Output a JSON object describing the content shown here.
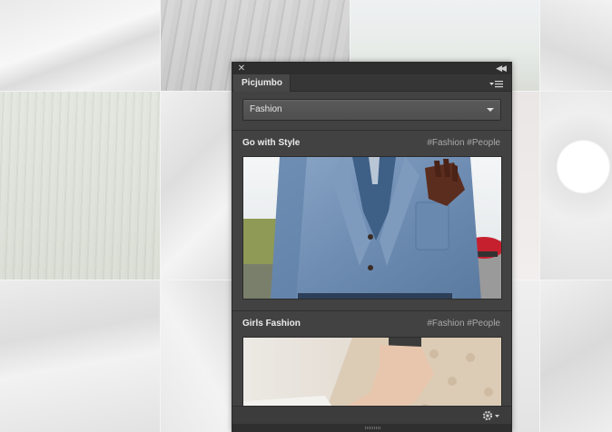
{
  "panel": {
    "tab_label": "Picjumbo",
    "category_dropdown": {
      "selected": "Fashion"
    }
  },
  "cards": [
    {
      "title": "Go with Style",
      "tags": "#Fashion #People"
    },
    {
      "title": "Girls Fashion",
      "tags": "#Fashion #People"
    }
  ],
  "icons": {
    "close": "close-icon",
    "collapse": "double-chevron-left-icon",
    "panel_menu": "panel-menu-icon",
    "dropdown_caret": "chevron-down-icon",
    "settings": "gear-icon",
    "grip": "resize-grip-icon"
  },
  "colors": {
    "panel_bg": "#424242",
    "titlebar_bg": "#2e2e2e",
    "text_primary": "#ececec",
    "text_tags": "#a9a9a9"
  }
}
